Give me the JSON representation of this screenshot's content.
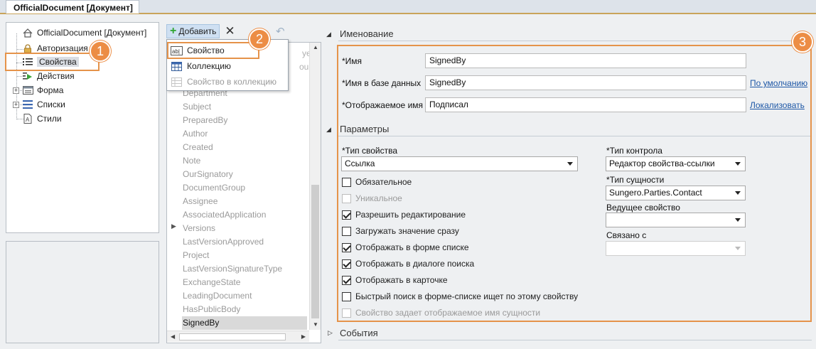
{
  "tab": {
    "title": "OfficialDocument [Документ]"
  },
  "tree": {
    "items": [
      {
        "label": "OfficialDocument [Документ]",
        "icon": "home-icon"
      },
      {
        "label": "Авторизация",
        "icon": "lock-icon"
      },
      {
        "label": "Свойства",
        "icon": "properties-list-icon"
      },
      {
        "label": "Действия",
        "icon": "actions-icon"
      },
      {
        "label": "Форма",
        "icon": "form-icon"
      },
      {
        "label": "Списки",
        "icon": "lists-icon"
      },
      {
        "label": "Стили",
        "icon": "styles-icon"
      }
    ]
  },
  "toolbar": {
    "add_label": "Добавить"
  },
  "menu": {
    "items": [
      {
        "label": "Свойство",
        "icon": "property-icon",
        "enabled": true
      },
      {
        "label": "Коллекцию",
        "icon": "collection-icon",
        "enabled": true
      },
      {
        "label": "Свойство в коллекцию",
        "icon": "collection-property-icon",
        "enabled": false
      }
    ]
  },
  "properties_list": {
    "partial": [
      "yee",
      "ount"
    ],
    "items": [
      "Department",
      "Subject",
      "PreparedBy",
      "Author",
      "Created",
      "Note",
      "OurSignatory",
      "DocumentGroup",
      "Assignee",
      "AssociatedApplication",
      "Versions",
      "LastVersionApproved",
      "Project",
      "LastVersionSignatureType",
      "ExchangeState",
      "LeadingDocument",
      "HasPublicBody",
      "SignedBy"
    ],
    "selected": "SignedBy"
  },
  "badges": [
    "1",
    "2",
    "3"
  ],
  "naming": {
    "title": "Именование",
    "name_label": "*Имя",
    "name_value": "SignedBy",
    "db_name_label": "*Имя в базе данных",
    "db_name_value": "SignedBy",
    "default_link": "По умолчанию",
    "display_name_label": "*Отображаемое имя",
    "display_name_value": "Подписал",
    "localize_link": "Локализовать"
  },
  "params": {
    "title": "Параметры",
    "prop_type_label": "*Тип свойства",
    "prop_type_value": "Ссылка",
    "control_type_label": "*Тип контрола",
    "control_type_value": "Редактор свойства-ссылки",
    "entity_type_label": "*Тип сущности",
    "entity_type_value": "Sungero.Parties.Contact",
    "leading_prop_label": "Ведущее свойство",
    "leading_prop_value": "",
    "linked_label": "Связано с",
    "linked_value": "",
    "checkboxes": [
      {
        "label": "Обязательное",
        "checked": false,
        "enabled": true
      },
      {
        "label": "Уникальное",
        "checked": false,
        "enabled": false
      },
      {
        "label": "Разрешить редактирование",
        "checked": true,
        "enabled": true
      },
      {
        "label": "Загружать значение сразу",
        "checked": false,
        "enabled": true
      },
      {
        "label": "Отображать в форме списке",
        "checked": true,
        "enabled": true
      },
      {
        "label": "Отображать в диалоге поиска",
        "checked": true,
        "enabled": true
      },
      {
        "label": "Отображать в карточке",
        "checked": true,
        "enabled": true
      },
      {
        "label": "Быстрый поиск в форме-списке ищет по этому свойству",
        "checked": false,
        "enabled": true
      },
      {
        "label": "Свойство задает отображаемое имя сущности",
        "checked": false,
        "enabled": false
      }
    ]
  },
  "events": {
    "title": "События"
  },
  "colors": {
    "accent": "#ec8d45",
    "link": "#1d57a6",
    "selection": "#d9d9d9"
  }
}
